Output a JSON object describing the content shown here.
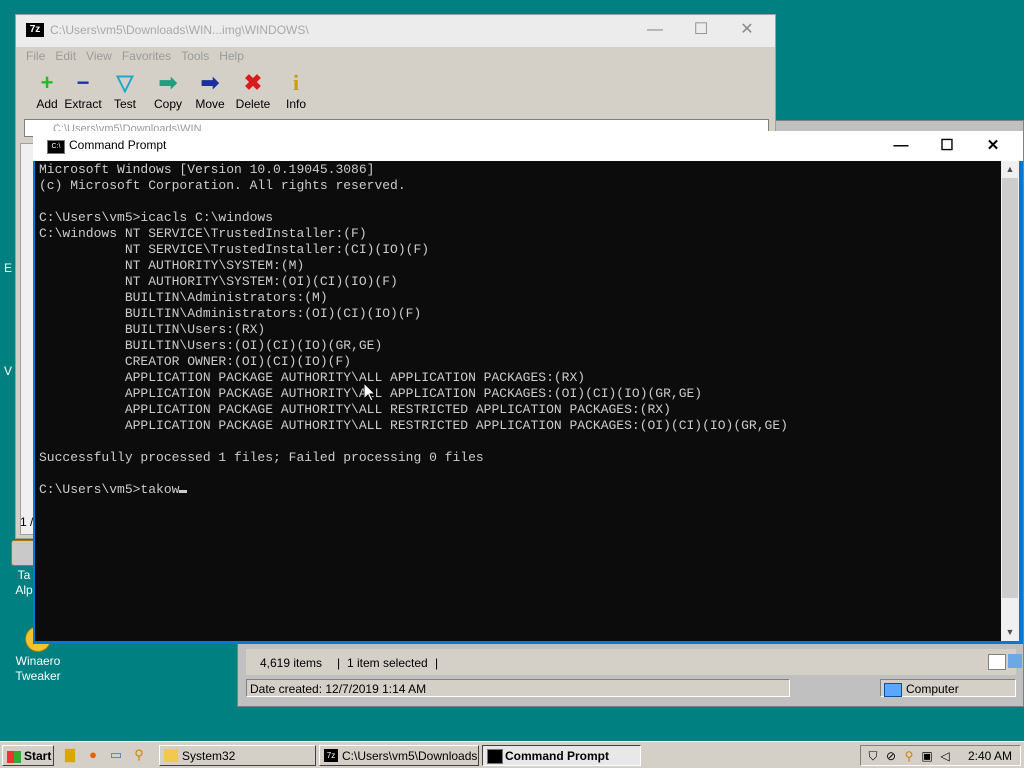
{
  "desktop": {
    "icons": [
      {
        "label": "Ta\nAlp",
        "icon": "shortcut-icon"
      },
      {
        "label": "Winaero Tweaker",
        "icon": "winaero-tweaker-icon"
      }
    ],
    "left_fragments": [
      "E",
      "V"
    ]
  },
  "explorer": {
    "status": {
      "items_count": "4,619 items",
      "selected": "1 item selected",
      "separator": "|"
    },
    "details": {
      "date_created": "Date created: 12/7/2019 1:14 AM",
      "location": "Computer"
    }
  },
  "zip": {
    "title": "C:\\Users\\vm5\\Downloads\\WIN...img\\WINDOWS\\",
    "app_badge": "7z",
    "menu": [
      "File",
      "Edit",
      "View",
      "Favorites",
      "Tools",
      "Help"
    ],
    "toolbar": [
      {
        "label": "Add",
        "icon": "plus-icon",
        "glyph": "+",
        "color": "#1fbf1f"
      },
      {
        "label": "Extract",
        "icon": "minus-icon",
        "glyph": "−",
        "color": "#1d2fbf"
      },
      {
        "label": "Test",
        "icon": "test-check-icon",
        "glyph": "▽",
        "color": "#1fa8c8"
      },
      {
        "label": "Copy",
        "icon": "copy-arrow-icon",
        "glyph": "➡",
        "color": "#1f9f7f"
      },
      {
        "label": "Move",
        "icon": "move-arrow-icon",
        "glyph": "➡",
        "color": "#1d2f9f"
      },
      {
        "label": "Delete",
        "icon": "delete-x-icon",
        "glyph": "✖",
        "color": "#d81b1b"
      },
      {
        "label": "Info",
        "icon": "info-icon",
        "glyph": "i",
        "color": "#c8a000"
      }
    ],
    "address": "C:\\Users\\vm5\\Downloads\\WIN",
    "left_fragment": "1 /"
  },
  "cmd": {
    "title": "Command Prompt",
    "buttons": {
      "minimize": "—",
      "maximize": "☐",
      "close": "✕"
    },
    "lines": [
      "Microsoft Windows [Version 10.0.19045.3086]",
      "(c) Microsoft Corporation. All rights reserved.",
      "",
      "C:\\Users\\vm5>icacls C:\\windows",
      "C:\\windows NT SERVICE\\TrustedInstaller:(F)",
      "           NT SERVICE\\TrustedInstaller:(CI)(IO)(F)",
      "           NT AUTHORITY\\SYSTEM:(M)",
      "           NT AUTHORITY\\SYSTEM:(OI)(CI)(IO)(F)",
      "           BUILTIN\\Administrators:(M)",
      "           BUILTIN\\Administrators:(OI)(CI)(IO)(F)",
      "           BUILTIN\\Users:(RX)",
      "           BUILTIN\\Users:(OI)(CI)(IO)(GR,GE)",
      "           CREATOR OWNER:(OI)(CI)(IO)(F)",
      "           APPLICATION PACKAGE AUTHORITY\\ALL APPLICATION PACKAGES:(RX)",
      "           APPLICATION PACKAGE AUTHORITY\\ALL APPLICATION PACKAGES:(OI)(CI)(IO)(GR,GE)",
      "           APPLICATION PACKAGE AUTHORITY\\ALL RESTRICTED APPLICATION PACKAGES:(RX)",
      "           APPLICATION PACKAGE AUTHORITY\\ALL RESTRICTED APPLICATION PACKAGES:(OI)(CI)(IO)(GR,GE)",
      "",
      "Successfully processed 1 files; Failed processing 0 files",
      ""
    ],
    "prompt": "C:\\Users\\vm5>",
    "input": "takow"
  },
  "taskbar": {
    "start_label": "Start",
    "quick_launch": [
      "explorer-folder-icon",
      "firefox-icon",
      "keyboard-icon",
      "search-icon"
    ],
    "tasks": [
      {
        "label": "System32",
        "icon": "folder-icon",
        "active": false
      },
      {
        "label": "C:\\Users\\vm5\\Downloads...",
        "icon": "7zip-icon",
        "active": false
      },
      {
        "label": "Command Prompt",
        "icon": "cmd-icon",
        "active": true
      }
    ],
    "tray_icons": [
      "shield-icon",
      "network-off-icon",
      "search-tray-icon",
      "display-icon",
      "volume-muted-icon"
    ],
    "clock": "2:40 AM"
  }
}
